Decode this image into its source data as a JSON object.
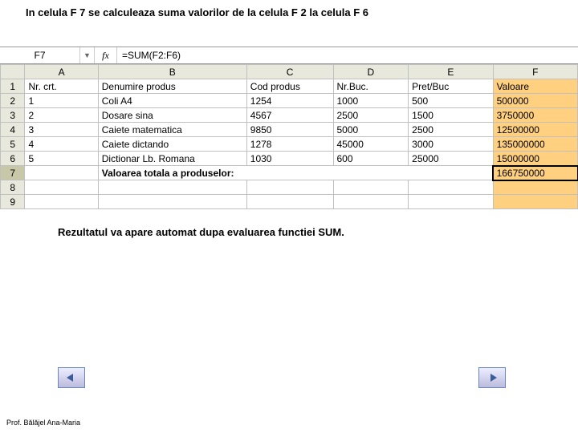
{
  "title": "In celula F 7 se calculeaza suma valorilor de la celula F 2 la celula F 6",
  "caption": "Rezultatul va apare automat dupa evaluarea functiei SUM.",
  "footer": "Prof. Bălăjel Ana-Maria",
  "formula_bar": {
    "name_box": "F7",
    "fx_label": "fx",
    "formula": "=SUM(F2:F6)"
  },
  "columns": [
    "A",
    "B",
    "C",
    "D",
    "E",
    "F"
  ],
  "headers": {
    "A": "Nr. crt.",
    "B": "Denumire produs",
    "C": "Cod produs",
    "D": "Nr.Buc.",
    "E": "Pret/Buc",
    "F": "Valoare"
  },
  "rows": [
    {
      "n": "1",
      "A": "1",
      "B": "Coli A4",
      "C": "1254",
      "D": "1000",
      "E": "500",
      "F": "500000"
    },
    {
      "n": "2",
      "A": "2",
      "B": "Dosare sina",
      "C": "4567",
      "D": "2500",
      "E": "1500",
      "F": "3750000"
    },
    {
      "n": "3",
      "A": "3",
      "B": "Caiete matematica",
      "C": "9850",
      "D": "5000",
      "E": "2500",
      "F": "12500000"
    },
    {
      "n": "4",
      "A": "4",
      "B": "Caiete dictando",
      "C": "1278",
      "D": "45000",
      "E": "3000",
      "F": "135000000"
    },
    {
      "n": "5",
      "A": "5",
      "B": "Dictionar Lb. Romana",
      "C": "1030",
      "D": "600",
      "E": "25000",
      "F": "15000000"
    }
  ],
  "total": {
    "label": "Valoarea totala a produselor:",
    "value": "166750000"
  },
  "row_numbers": [
    "1",
    "2",
    "3",
    "4",
    "5",
    "6",
    "7",
    "8",
    "9"
  ]
}
